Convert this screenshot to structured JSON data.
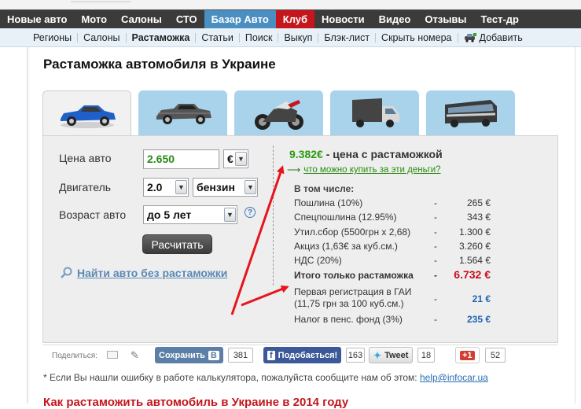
{
  "top_nav": {
    "items": [
      {
        "label": "Новые авто"
      },
      {
        "label": "Мото"
      },
      {
        "label": "Салоны"
      },
      {
        "label": "СТО"
      },
      {
        "label": "Базар Авто",
        "active": true
      },
      {
        "label": "Клуб",
        "highlight": true
      },
      {
        "label": "Новости"
      },
      {
        "label": "Видео"
      },
      {
        "label": "Отзывы"
      },
      {
        "label": "Тест-др"
      }
    ],
    "active_color": "#4a8ec2",
    "club_color": "#c4161c"
  },
  "sub_nav": {
    "items": [
      "Регионы",
      "Салоны",
      "Растаможка",
      "Статьи",
      "Поиск",
      "Выкуп",
      "Блэк-лист",
      "Скрыть номера"
    ],
    "add_label": "Добавить"
  },
  "page": {
    "title": "Растаможка автомобиля в Украине"
  },
  "vehicle_tabs": [
    {
      "icon": "sports-car-icon",
      "selected": true
    },
    {
      "icon": "muscle-car-icon"
    },
    {
      "icon": "motorcycle-icon"
    },
    {
      "icon": "truck-icon"
    },
    {
      "icon": "bus-icon"
    }
  ],
  "form": {
    "price_label": "Цена авто",
    "price_value": "2.650",
    "currency_value": "€",
    "engine_label": "Двигатель",
    "engine_volume": "2.0",
    "fuel_type": "бензин",
    "age_label": "Возраст авто",
    "age_value": "до 5 лет",
    "help_symbol": "?",
    "calc_button": "Расчитать",
    "find_link": "Найти авто без растаможки"
  },
  "result": {
    "total": "9.382€",
    "total_suffix": " - цена с растаможкой",
    "what_buy_link": "что можно купить за эти деньги?",
    "included_label": "В том числе:",
    "rows": [
      {
        "name": "Пошлина (10%)",
        "value": "265 €"
      },
      {
        "name": "Спецпошлина (12.95%)",
        "value": "343 €"
      },
      {
        "name": "Утил.сбор (5500грн х 2,68)",
        "value": "1.300 €"
      },
      {
        "name": "Акциз (1,63€ за куб.см.)",
        "value": "3.260 €"
      },
      {
        "name": "НДС (20%)",
        "value": "1.564 €"
      }
    ],
    "customs_total_label": "Итого только растаможка",
    "customs_total_value": "6.732 €",
    "registration_label_1": "Первая регистрация в ГАИ",
    "registration_label_2": "(11,75 грн за 100 куб.см.)",
    "registration_value": "21 €",
    "pension_label": "Налог в пенс. фонд (3%)",
    "pension_value": "235 €",
    "dash": "-",
    "colors": {
      "total": "#2a9b12",
      "customs_total": "#c8101a",
      "blue_values": "#1d63b0"
    }
  },
  "share": {
    "label": "Поделиться:",
    "vk_label": "Сохранить",
    "vk_badge": "В",
    "vk_count": "381",
    "fb_label": "Подобається!",
    "fb_count": "163",
    "tw_label": "Tweet",
    "tw_count": "18",
    "gp_label": "+1",
    "gp_count": "52"
  },
  "footnote": {
    "text": "* Если Вы нашли ошибку в работе калькулятора, пожалуйста сообщите нам об этом: ",
    "email": "help@infocar.ua"
  },
  "bottom_heading": "Как растаможить автомобиль в Украине в 2014 году",
  "annotation_color": "#e8141c"
}
